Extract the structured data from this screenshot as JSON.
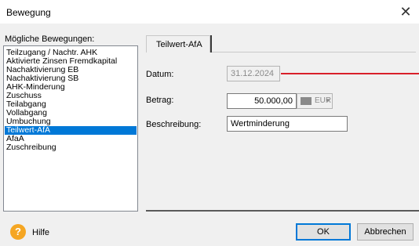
{
  "window": {
    "title": "Bewegung"
  },
  "list": {
    "label": "Mögliche Bewegungen:",
    "items": [
      "Teilzugang / Nachtr. AHK",
      "Aktivierte Zinsen Fremdkapital",
      "Nachaktivierung EB",
      "Nachaktivierung SB",
      "AHK-Minderung",
      "Zuschuss",
      "Teilabgang",
      "Vollabgang",
      "Umbuchung",
      "Teilwert-AfA",
      "AfaA",
      "Zuschreibung"
    ],
    "selected": "Teilwert-AfA"
  },
  "tab": {
    "label": "Teilwert-AfA"
  },
  "form": {
    "datum_label": "Datum:",
    "datum_value": "31.12.2024",
    "betrag_label": "Betrag:",
    "betrag_value": "50.000,00",
    "currency": "EUR",
    "beschreibung_label": "Beschreibung:",
    "beschreibung_value": "Wertminderung"
  },
  "footer": {
    "help_label": "Hilfe",
    "ok_label": "OK",
    "cancel_label": "Abbrechen"
  },
  "colors": {
    "selection": "#0078d7",
    "marker_line": "#d9202a",
    "help_icon": "#f5a623"
  },
  "icons": [
    "close-icon",
    "help-icon",
    "chevron-down-icon"
  ]
}
